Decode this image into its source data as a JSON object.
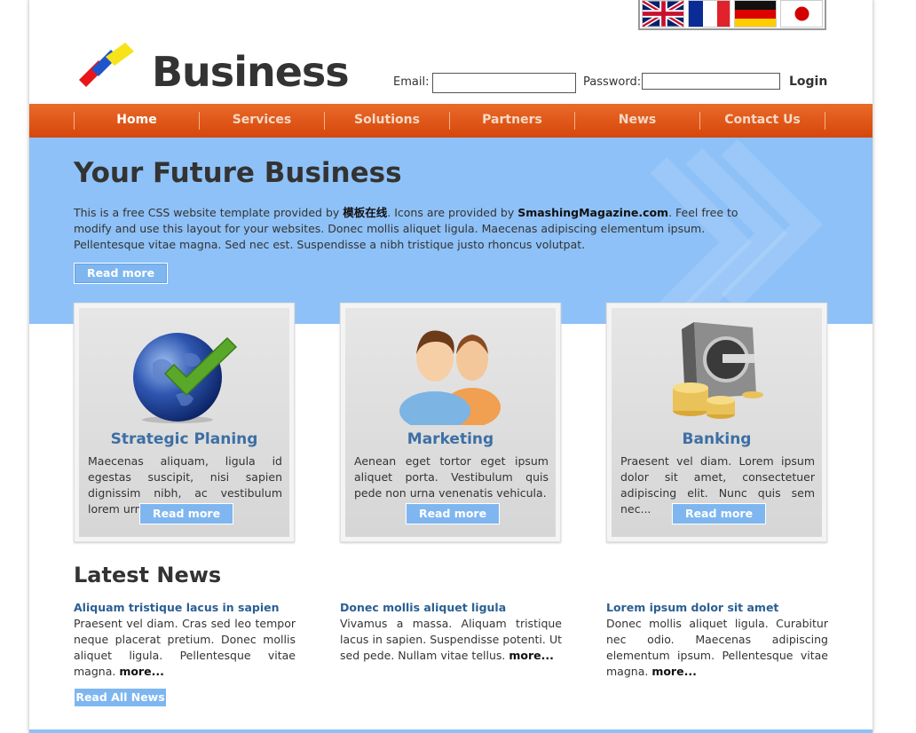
{
  "header": {
    "brand": "Business",
    "email_label": "Email:",
    "email_value": "",
    "password_label": "Password:",
    "password_value": "",
    "login_label": "Login",
    "flags": [
      "uk-flag-icon",
      "france-flag-icon",
      "germany-flag-icon",
      "japan-flag-icon"
    ]
  },
  "nav": {
    "items": [
      {
        "label": "Home",
        "active": true
      },
      {
        "label": "Services",
        "active": false
      },
      {
        "label": "Solutions",
        "active": false
      },
      {
        "label": "Partners",
        "active": false
      },
      {
        "label": "News",
        "active": false
      },
      {
        "label": "Contact Us",
        "active": false
      }
    ]
  },
  "hero": {
    "title": "Your Future Business",
    "text_1": "This is a free CSS website template provided by ",
    "provider": "模板在线",
    "text_2": ". Icons are provided by ",
    "icons_source": "SmashingMagazine.com",
    "text_3": ". Feel free to modify and use this layout for your websites. Donec mollis aliquet ligula. Maecenas adipiscing elementum ipsum. Pellentesque vitae magna. Sed nec est. Suspendisse a nibh tristique justo rhoncus volutpat.",
    "read_more": "Read more"
  },
  "cards": [
    {
      "title": "Strategic Planing",
      "text": "Maecenas aliquam, ligula id egestas suscipit, nisi sapien dignissim nibh, ac vestibulum lorem urna in neque.",
      "button": "Read more",
      "icon": "globe-check-icon"
    },
    {
      "title": "Marketing",
      "text": "Aenean eget tortor eget ipsum aliquet porta. Vestibulum quis pede non urna venenatis vehicula.",
      "button": "Read more",
      "icon": "people-icon"
    },
    {
      "title": "Banking",
      "text": "Praesent vel diam. Lorem ipsum dolor sit amet, consectetuer adipiscing elit. Nunc quis sem nec...",
      "button": "Read more",
      "icon": "safe-coins-icon"
    }
  ],
  "news": {
    "title": "Latest News",
    "items": [
      {
        "headline": "Aliquam tristique lacus in sapien",
        "text": "Praesent vel diam. Cras sed leo tempor neque placerat pretium. Donec mollis aliquet ligula. Pellentesque vitae magna.",
        "more": "more..."
      },
      {
        "headline": "Donec mollis aliquet ligula",
        "text": "Vivamus a massa. Aliquam tristique lacus in sapien. Suspendisse potenti. Ut sed pede. Nullam vitae tellus.",
        "more": "more..."
      },
      {
        "headline": "Lorem ipsum dolor sit amet",
        "text": "Donec mollis aliquet ligula. Curabitur nec odio. Maecenas adipiscing elementum ipsum. Pellentesque vitae magna.",
        "more": "more..."
      }
    ],
    "read_all": "Read All News"
  },
  "colors": {
    "nav": "#e0581a",
    "hero": "#8ec1f7",
    "button": "#7fb6ef",
    "card_title": "#3d6fa4",
    "news_headline": "#2b5f93"
  }
}
